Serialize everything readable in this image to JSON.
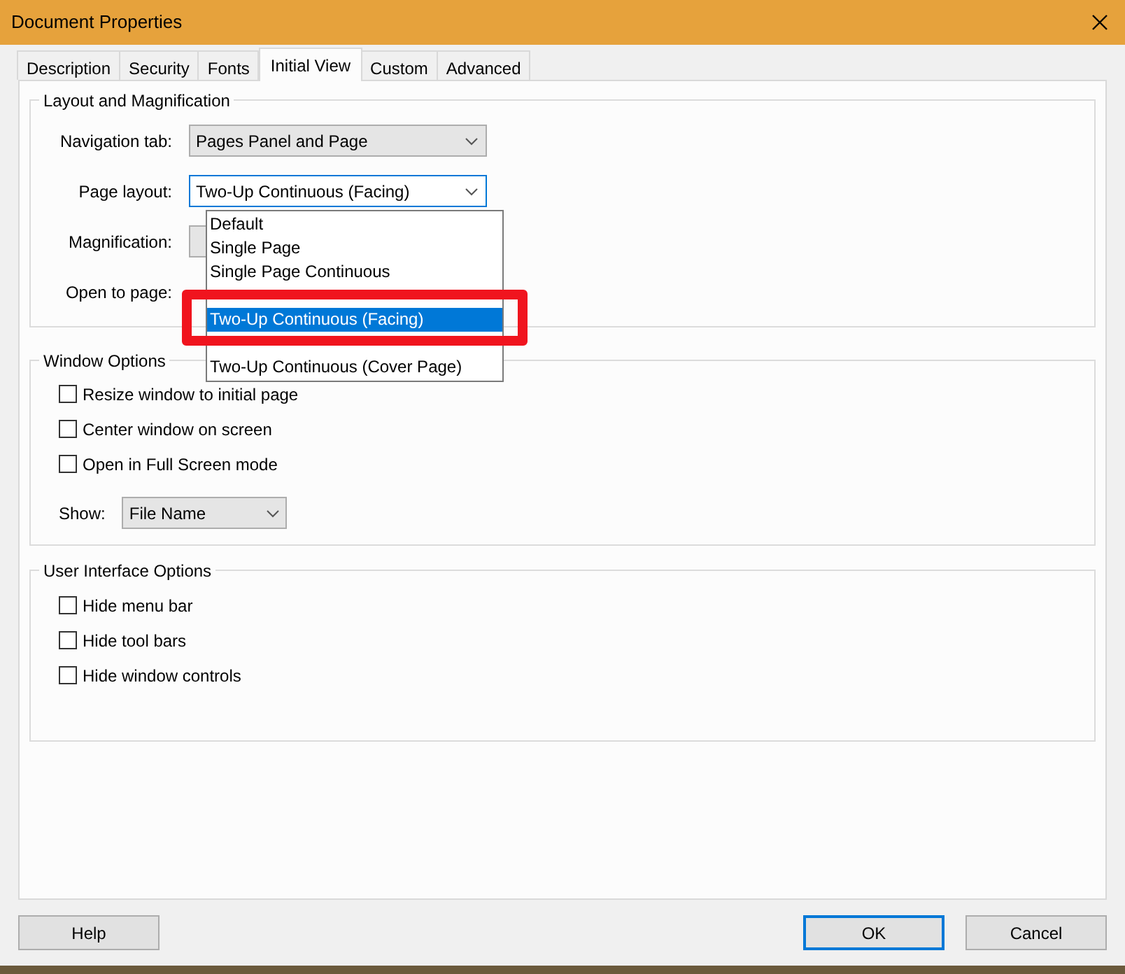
{
  "window": {
    "title": "Document Properties"
  },
  "tabs": [
    {
      "label": "Description",
      "selected": false
    },
    {
      "label": "Security",
      "selected": false
    },
    {
      "label": "Fonts",
      "selected": false
    },
    {
      "label": "Initial View",
      "selected": true
    },
    {
      "label": "Custom",
      "selected": false
    },
    {
      "label": "Advanced",
      "selected": false
    }
  ],
  "layout_group": {
    "title": "Layout and Magnification",
    "navigation_tab": {
      "label": "Navigation tab:",
      "value": "Pages Panel and Page"
    },
    "page_layout": {
      "label": "Page layout:",
      "value": "Two-Up Continuous (Facing)",
      "expanded": true,
      "options": [
        {
          "label": "Default",
          "selected": false
        },
        {
          "label": "Single Page",
          "selected": false
        },
        {
          "label": "Single Page Continuous",
          "selected": false
        },
        {
          "label": "Two-Up Continuous (Facing)",
          "selected": true
        },
        {
          "label": "Two-Up Continuous (Cover Page)",
          "selected": false
        }
      ]
    },
    "magnification": {
      "label": "Magnification:"
    },
    "open_to_page": {
      "label": "Open to page:"
    }
  },
  "window_options": {
    "title": "Window Options",
    "checkboxes": [
      {
        "label": "Resize window to initial page",
        "checked": false
      },
      {
        "label": "Center window on screen",
        "checked": false
      },
      {
        "label": "Open in Full Screen mode",
        "checked": false
      }
    ],
    "show": {
      "label": "Show:",
      "value": "File Name"
    }
  },
  "ui_options": {
    "title": "User Interface Options",
    "checkboxes": [
      {
        "label": "Hide menu bar",
        "checked": false
      },
      {
        "label": "Hide tool bars",
        "checked": false
      },
      {
        "label": "Hide window controls",
        "checked": false
      }
    ]
  },
  "buttons": [
    {
      "label": "Help",
      "default": false
    },
    {
      "label": "OK",
      "default": true
    },
    {
      "label": "Cancel",
      "default": false
    }
  ]
}
